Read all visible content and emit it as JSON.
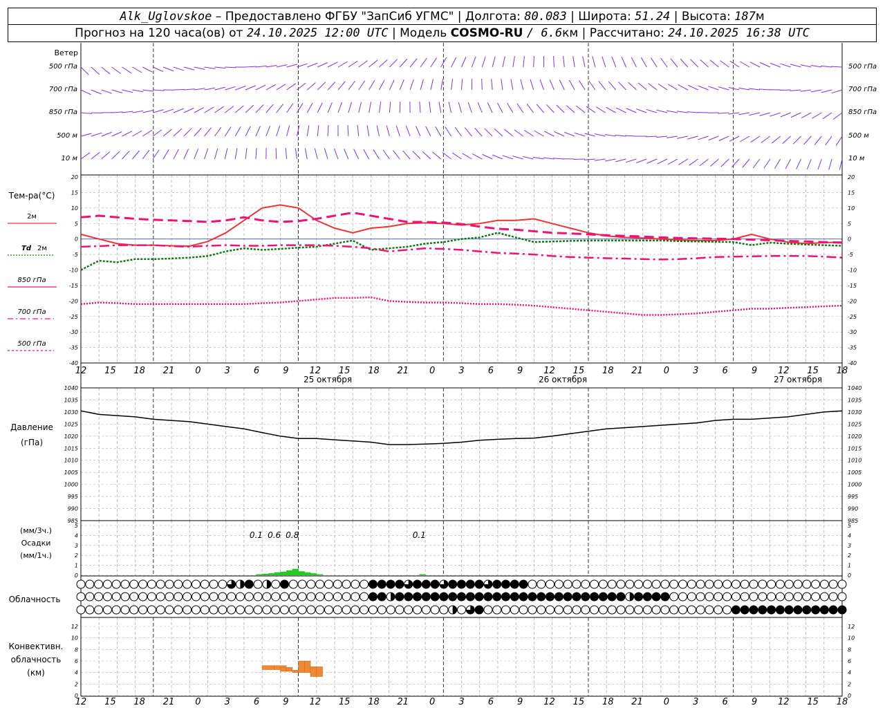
{
  "header": {
    "station": "Alk_Uglovskoe",
    "provider": "– Предоставлено ФГБУ \"ЗапСиб УГМС\"",
    "lon_label": "| Долгота:",
    "lon_value": "80.083",
    "lat_label": "| Широта:",
    "lat_value": "51.24",
    "alt_label": "| Высота:",
    "alt_value": "187",
    "alt_unit": "м",
    "forecast_prefix": "Прогноз на 120 часа(ов) от",
    "forecast_time": "24.10.2025 12:00 UTC",
    "model_label": "| Модель",
    "model_name": "COSMO-RU",
    "model_res": "/ 6.6",
    "model_res_unit": "км",
    "calc_label": "| Рассчитано:",
    "calc_time": "24.10.2025 16:38 UTC"
  },
  "colors": {
    "wind": "#8a2be2",
    "t2m": "#ee3333",
    "td2m": "#117711",
    "t850": "#ee1177",
    "t700": "#ee1177",
    "t500": "#ee1177",
    "pressure": "#000000",
    "precip_3h": "#22cc22",
    "convective": "#ee8833",
    "grid": "#b0b0b0"
  },
  "time_axis": {
    "labels": [
      "12",
      "15",
      "18",
      "21",
      "0",
      "3",
      "6",
      "9",
      "12",
      "15",
      "18",
      "21",
      "0",
      "3",
      "6",
      "9",
      "12",
      "15",
      "18",
      "21",
      "0",
      "3",
      "6",
      "9",
      "12",
      "15",
      "18"
    ],
    "dates": [
      "25 октября",
      "26 октября",
      "27 октября"
    ]
  },
  "wind_panel": {
    "title": "Ветер",
    "levels": [
      "500 гПа",
      "700 гПа",
      "850 гПа",
      "500 м",
      "10 м"
    ]
  },
  "temp_panel": {
    "title": "Тем-ра(°С)",
    "legend": [
      {
        "label": "2м"
      },
      {
        "label": "Td",
        "suffix": "2м"
      },
      {
        "label": "850 гПа"
      },
      {
        "label": "700 гПа"
      },
      {
        "label": "500 гПа"
      }
    ]
  },
  "pressure_panel": {
    "title": "Давление",
    "unit": "(гПа)"
  },
  "precip_panel": {
    "unit_3h": "(мм/3ч.)",
    "title": "Осадки",
    "unit_1h": "(мм/1ч.)",
    "annotations": [
      {
        "text": "0.1",
        "t": 29
      },
      {
        "text": "0.6",
        "t": 32
      },
      {
        "text": "0.8",
        "t": 35
      },
      {
        "text": "0.1",
        "t": 56
      }
    ]
  },
  "cloud_panel": {
    "title": "Облачность",
    "rows": [
      "000000000000000003240204000000000444434443444434444000000000000000000000000000000000000",
      "000000000000000000000000000000000442444444444444444444444444442444400000000000000000000",
      "000000000000000000000000000000000000000000203400000000000000000000000000004444444444444"
    ]
  },
  "conv_panel": {
    "title_1": "Конвективн.",
    "title_2": "облачность",
    "unit": "(км)",
    "ylim": [
      0,
      13
    ]
  },
  "chart_data": [
    {
      "type": "line",
      "title": "Тем-ра(°С)",
      "x_hours": [
        0,
        3,
        6,
        9,
        12,
        15,
        18,
        21,
        24,
        27,
        30,
        33,
        36,
        39,
        42,
        45,
        48,
        51,
        54,
        57,
        60,
        63,
        66,
        69,
        72,
        75,
        78,
        81,
        84,
        87,
        90,
        93,
        96,
        99,
        102,
        105,
        108,
        111,
        114,
        117,
        120,
        123,
        126
      ],
      "ylim": [
        -40,
        20
      ],
      "series": [
        {
          "name": "2м",
          "values": [
            1.5,
            0,
            -1.5,
            -2,
            -2,
            -2.2,
            -2.3,
            -0.8,
            2,
            6,
            10,
            11,
            10,
            6,
            3.5,
            2,
            3.5,
            4,
            5,
            5.2,
            5,
            4.5,
            5,
            6,
            6,
            6.5,
            5,
            3.5,
            2,
            1,
            0.5,
            0.3,
            0,
            -0.3,
            -0.5,
            -0.5,
            0,
            1.5,
            0,
            -1,
            -1.5,
            -1.2,
            -1
          ]
        },
        {
          "name": "Td 2м",
          "values": [
            -10,
            -7,
            -7.5,
            -6.5,
            -6.5,
            -6.3,
            -6,
            -5.5,
            -4,
            -3,
            -3.5,
            -3.2,
            -2.8,
            -2.5,
            -1.5,
            -0.5,
            -3.5,
            -3,
            -2.5,
            -1.5,
            -1,
            0,
            0.5,
            2,
            0.5,
            -1,
            -0.8,
            -0.6,
            -0.5,
            -0.5,
            -0.5,
            -0.5,
            -0.5,
            -0.7,
            -0.8,
            -0.9,
            -1,
            -2,
            -1.2,
            -1.5,
            -1.8,
            -2,
            -2.2
          ]
        },
        {
          "name": "850 гПа",
          "values": [
            7,
            7.5,
            7,
            6.5,
            6.2,
            6,
            5.8,
            5.5,
            6,
            7,
            6,
            5.5,
            5.8,
            6.5,
            7.5,
            8.5,
            7.5,
            6.5,
            5.5,
            5.5,
            5.3,
            4.8,
            4,
            3.3,
            3,
            2.5,
            2,
            1.8,
            1.5,
            1.2,
            1,
            0.8,
            0.5,
            0.3,
            0.2,
            0.1,
            0,
            -0.2,
            -0.4,
            -0.6,
            -0.8,
            -1,
            -1.2
          ]
        },
        {
          "name": "700 гПа",
          "values": [
            -2.5,
            -2.3,
            -2,
            -2,
            -2,
            -2.3,
            -2.5,
            -2.2,
            -2,
            -2.2,
            -2.2,
            -2,
            -2,
            -2,
            -2.2,
            -2.5,
            -3,
            -4,
            -3.5,
            -3,
            -3.2,
            -3.5,
            -4,
            -4.5,
            -4.7,
            -5,
            -5.5,
            -5.8,
            -6,
            -6.2,
            -6.3,
            -6.5,
            -6.6,
            -6.5,
            -6.2,
            -5.8,
            -5.7,
            -5.6,
            -5.5,
            -5.5,
            -5.5,
            -5.7,
            -6
          ]
        },
        {
          "name": "500 гПа",
          "values": [
            -21,
            -20.5,
            -20.7,
            -21,
            -21,
            -21,
            -21,
            -21,
            -21,
            -21,
            -20.7,
            -20.5,
            -20,
            -19.5,
            -19,
            -19,
            -18.8,
            -20,
            -20.3,
            -20.5,
            -20.5,
            -20.7,
            -21,
            -21,
            -21.2,
            -21.5,
            -22,
            -22.5,
            -23,
            -23.5,
            -24,
            -24.5,
            -24.5,
            -24.3,
            -24,
            -23.5,
            -23,
            -22.5,
            -22.5,
            -22.2,
            -22,
            -21.7,
            -21.5
          ]
        }
      ]
    },
    {
      "type": "line",
      "title": "Давление",
      "x_hours": [
        0,
        3,
        6,
        9,
        12,
        15,
        18,
        21,
        24,
        27,
        30,
        33,
        36,
        39,
        42,
        45,
        48,
        51,
        54,
        57,
        60,
        63,
        66,
        69,
        72,
        75,
        78,
        81,
        84,
        87,
        90,
        93,
        96,
        99,
        102,
        105,
        108,
        111,
        114,
        117,
        120,
        123,
        126
      ],
      "ylim": [
        985,
        1040
      ],
      "series": [
        {
          "name": "Давление",
          "values": [
            1030.5,
            1029,
            1028.5,
            1028,
            1027,
            1026.5,
            1026,
            1025,
            1024,
            1023,
            1021.5,
            1020,
            1019,
            1019,
            1018.5,
            1018,
            1017.5,
            1016.5,
            1016.5,
            1016.7,
            1017,
            1017.5,
            1018.3,
            1018.7,
            1019,
            1019.2,
            1020,
            1021,
            1022,
            1023,
            1023.5,
            1024,
            1024.5,
            1025,
            1025.5,
            1026.5,
            1027,
            1027,
            1027.5,
            1028,
            1029,
            1030,
            1030.5
          ]
        }
      ]
    },
    {
      "type": "bar",
      "title": "Осадки",
      "ylabel": "(мм/1ч.)",
      "ylim": [
        0,
        5
      ],
      "x_hours": [
        29,
        30,
        31,
        32,
        33,
        34,
        35,
        36,
        37,
        38,
        39,
        56
      ],
      "values": [
        0.1,
        0.15,
        0.2,
        0.3,
        0.35,
        0.5,
        0.65,
        0.4,
        0.3,
        0.2,
        0.1,
        0.1
      ]
    },
    {
      "type": "bar",
      "title": "Конвективн. облачность",
      "ylabel": "(км)",
      "ylim": [
        0,
        13
      ],
      "bars": [
        {
          "t0": 30,
          "t1": 32,
          "lo": 4.5,
          "hi": 5.2
        },
        {
          "t0": 32,
          "t1": 34,
          "lo": 4.5,
          "hi": 5.2
        },
        {
          "t0": 33,
          "t1": 34,
          "lo": 4.2,
          "hi": 4.9
        },
        {
          "t0": 34,
          "t1": 35,
          "lo": 4.2,
          "hi": 4.9
        },
        {
          "t0": 35,
          "t1": 36,
          "lo": 4.0,
          "hi": 4.4
        },
        {
          "t0": 36,
          "t1": 37,
          "lo": 4.0,
          "hi": 6.0
        },
        {
          "t0": 37,
          "t1": 38,
          "lo": 4.0,
          "hi": 6.0
        },
        {
          "t0": 38,
          "t1": 39,
          "lo": 3.3,
          "hi": 5.0
        },
        {
          "t0": 39,
          "t1": 40,
          "lo": 3.3,
          "hi": 5.0
        }
      ]
    }
  ]
}
